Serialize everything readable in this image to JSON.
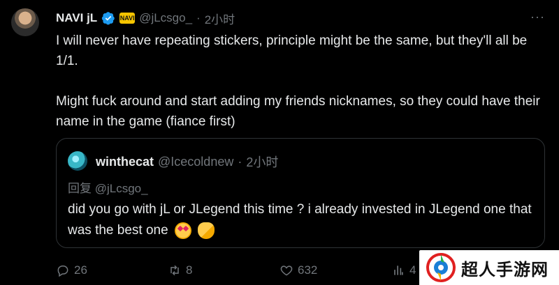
{
  "tweet": {
    "author_name": "NAVI jL",
    "badge_text": "NAVI",
    "handle": "@jLcsgo_",
    "separator": "·",
    "time": "2小时",
    "more": "···",
    "text": "I will never have repeating stickers, principle might be the same, but they'll all be 1/1.\n\nMight fuck around and start adding my friends nicknames, so they could have their name in the game (fiance first)"
  },
  "quote": {
    "author_name": "winthecat",
    "handle": "@Icecoldnew",
    "separator": "·",
    "time": "2小时",
    "reply_to": "回复 @jLcsgo_",
    "text": "did you go with jL or JLegend this time ? i already invested in JLegend one that was the best one"
  },
  "actions": {
    "replies": "26",
    "reposts": "8",
    "likes": "632",
    "views": "4"
  },
  "watermark": {
    "text": "超人手游网"
  },
  "colors": {
    "background": "#000000",
    "text": "#e7e9ea",
    "muted": "#71767b",
    "verified": "#1d9bf0",
    "border": "#2f3336"
  }
}
